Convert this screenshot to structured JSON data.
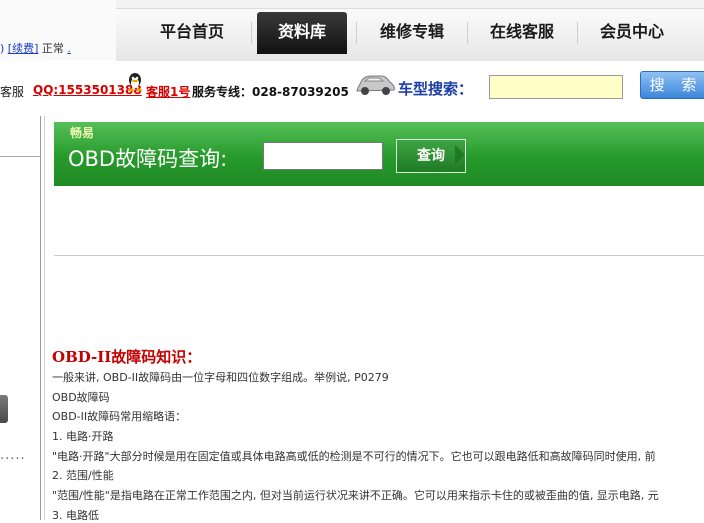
{
  "nav": {
    "tabs": [
      "平台首页",
      "资料库",
      "维修专辑",
      "在线客服",
      "会员中心"
    ],
    "active_index": 1
  },
  "user": {
    "renew_link": "[续费]",
    "status": "正常",
    "extra_link": "."
  },
  "infobar": {
    "left_label": "客服",
    "qq_label": "QQ:1553501388",
    "kf_label": "客服1号",
    "service_label": "服务专线：028-87039205",
    "search_label": "车型搜索：",
    "search_value": "",
    "search_button": "搜 索"
  },
  "obd": {
    "brand": "畅易",
    "title": "OBD故障码查询:",
    "input_value": "",
    "button": "查询"
  },
  "knowledge": {
    "title": "OBD-II故障码知识：",
    "lines": [
      "一般来讲, OBD-II故障码由一位字母和四位数字组成。举例说, P0279",
      "OBD故障码",
      "OBD-II故障码常用缩略语：",
      "1. 电路·开路",
      "\"电路·开路\"大部分时候是用在固定值或具体电路高或低的检测是不可行的情况下。它也可以跟电路低和高故障码同时使用, 前",
      "2. 范围/性能",
      "\"范围/性能\"是指电路在正常工作范围之内, 但对当前运行状况来讲不正确。它可以用来指示卡住的或被歪曲的值, 显示电路, 元",
      "3. 电路低"
    ]
  },
  "colors": {
    "nav_active": "#1a1a1a",
    "banner_green": "#279a2c",
    "link_red": "#d60000",
    "search_label_blue": "#1d3ea8"
  }
}
